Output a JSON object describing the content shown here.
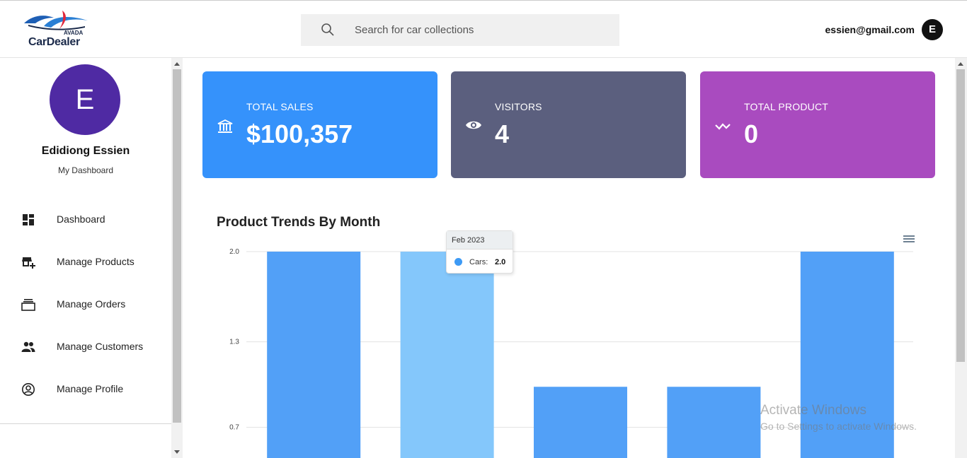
{
  "header": {
    "logo": {
      "brand": "CarDealer",
      "sub": "AVADA"
    },
    "search": {
      "placeholder": "Search for car collections",
      "value": ""
    },
    "user_email": "essien@gmail.com",
    "user_initial": "E"
  },
  "sidebar": {
    "profile": {
      "initial": "E",
      "name": "Edidiong Essien",
      "subtitle": "My Dashboard"
    },
    "items": [
      {
        "label": "Dashboard",
        "icon": "dashboard-icon"
      },
      {
        "label": "Manage Products",
        "icon": "store-add-icon"
      },
      {
        "label": "Manage Orders",
        "icon": "orders-icon"
      },
      {
        "label": "Manage Customers",
        "icon": "people-icon"
      },
      {
        "label": "Manage Profile",
        "icon": "account-circle-icon"
      }
    ]
  },
  "cards": [
    {
      "label": "TOTAL SALES",
      "value": "$100,357",
      "icon": "bank-icon",
      "color": "#3592fb"
    },
    {
      "label": "VISITORS",
      "value": "4",
      "icon": "eye-icon",
      "color": "#5b5f7e"
    },
    {
      "label": "TOTAL PRODUCT",
      "value": "0",
      "icon": "trend-icon",
      "color": "#a94bbf"
    }
  ],
  "chart": {
    "title": "Product Trends By Month",
    "tooltip": {
      "header": "Feb 2023",
      "series": "Cars:",
      "value": "2.0"
    }
  },
  "chart_data": {
    "type": "bar",
    "title": "Product Trends By Month",
    "series": [
      {
        "name": "Cars",
        "values": [
          2.0,
          2.0,
          1.0,
          1.0,
          2.0
        ]
      }
    ],
    "categories": [
      "",
      "Feb 2023",
      "",
      "",
      ""
    ],
    "y_ticks": [
      "2.0",
      "1.3",
      "0.7"
    ],
    "ylim": [
      0,
      2.0
    ],
    "bar_color": "#52a0f7",
    "highlight_color": "#84c7fb",
    "highlight_index": 1,
    "grid": true
  },
  "watermark": {
    "line1": "Activate Windows",
    "line2": "Go to Settings to activate Windows."
  }
}
